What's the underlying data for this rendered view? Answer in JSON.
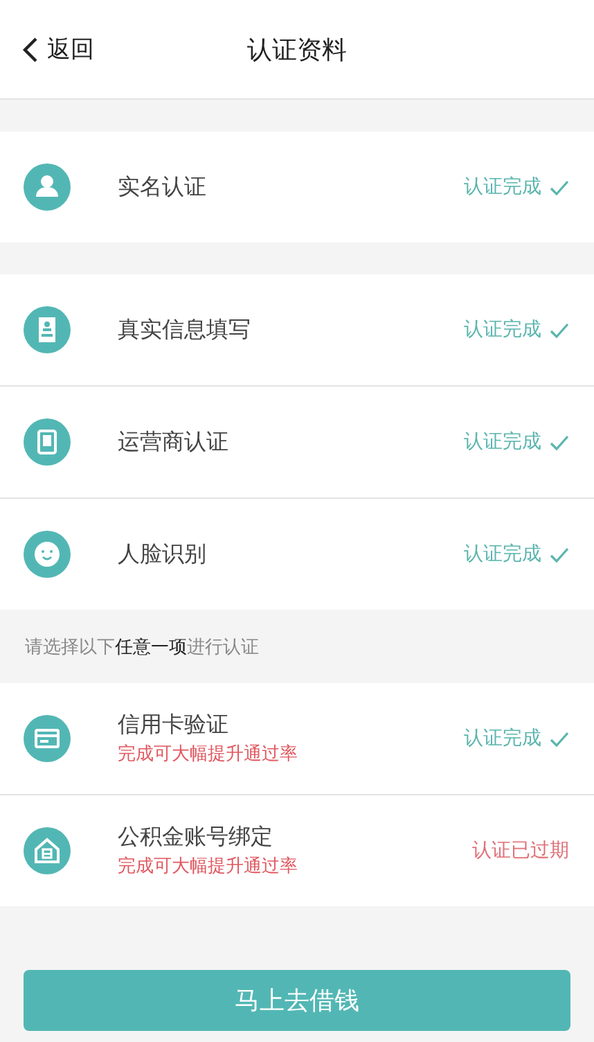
{
  "header": {
    "back": "返回",
    "title": "认证资料"
  },
  "groups": [
    {
      "items": [
        {
          "label": "实名认证",
          "status": "认证完成",
          "kind": "done"
        }
      ]
    },
    {
      "items": [
        {
          "label": "真实信息填写",
          "status": "认证完成",
          "kind": "done"
        },
        {
          "label": "运营商认证",
          "status": "认证完成",
          "kind": "done"
        },
        {
          "label": "人脸识别",
          "status": "认证完成",
          "kind": "done"
        }
      ]
    },
    {
      "note": "请选择以下**任意一项**进行认证",
      "items": [
        {
          "label": "信用卡验证",
          "hint": "完成可大幅提升通过率",
          "status": "认证完成",
          "kind": "done"
        },
        {
          "label": "公积金账号绑定",
          "hint": "完成可大幅提升通过率",
          "status": "认证已过期",
          "kind": "expired"
        }
      ]
    }
  ],
  "button": "马上去借钱"
}
